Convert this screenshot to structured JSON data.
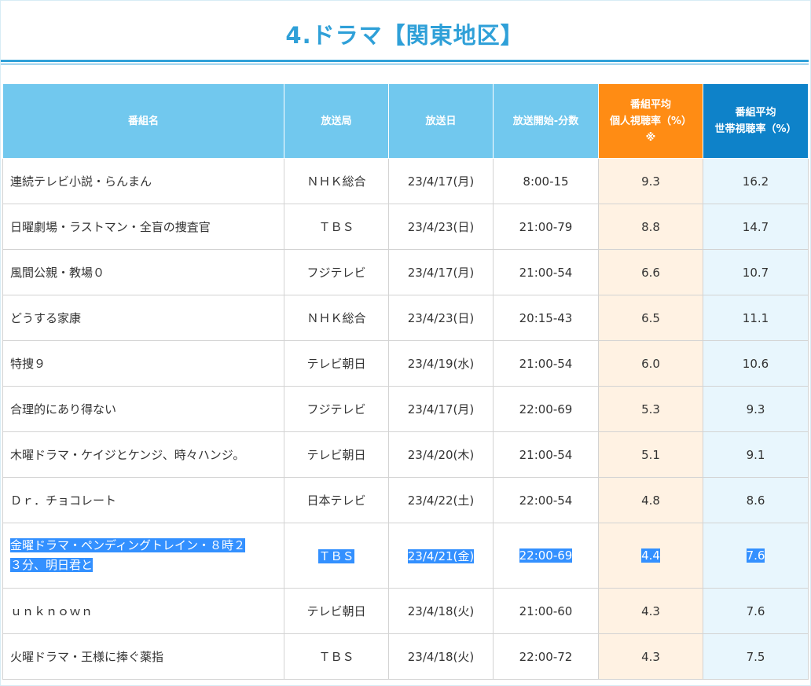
{
  "page": {
    "title": "4.ドラマ【関東地区】"
  },
  "table": {
    "headers": {
      "name": "番組名",
      "station": "放送局",
      "date": "放送日",
      "start": "放送開始-分数",
      "personal_line1": "番組平均",
      "personal_line2": "個人視聴率（%）",
      "personal_line3": "※",
      "household_line1": "番組平均",
      "household_line2": "世帯視聴率（%）"
    },
    "rows": [
      {
        "name": "連続テレビ小説・らんまん",
        "station": "ＮＨＫ総合",
        "date": "23/4/17(月)",
        "start": "8:00-15",
        "personal": "9.3",
        "household": "16.2"
      },
      {
        "name": "日曜劇場・ラストマン・全盲の捜査官",
        "station": "ＴＢＳ",
        "date": "23/4/23(日)",
        "start": "21:00-79",
        "personal": "8.8",
        "household": "14.7"
      },
      {
        "name": "風間公親・教場０",
        "station": "フジテレビ",
        "date": "23/4/17(月)",
        "start": "21:00-54",
        "personal": "6.6",
        "household": "10.7"
      },
      {
        "name": "どうする家康",
        "station": "ＮＨＫ総合",
        "date": "23/4/23(日)",
        "start": "20:15-43",
        "personal": "6.5",
        "household": "11.1"
      },
      {
        "name": "特捜９",
        "station": "テレビ朝日",
        "date": "23/4/19(水)",
        "start": "21:00-54",
        "personal": "6.0",
        "household": "10.6"
      },
      {
        "name": "合理的にあり得ない",
        "station": "フジテレビ",
        "date": "23/4/17(月)",
        "start": "22:00-69",
        "personal": "5.3",
        "household": "9.3"
      },
      {
        "name": "木曜ドラマ・ケイジとケンジ、時々ハンジ。",
        "station": "テレビ朝日",
        "date": "23/4/20(木)",
        "start": "21:00-54",
        "personal": "5.1",
        "household": "9.1"
      },
      {
        "name": "Ｄｒ．チョコレート",
        "station": "日本テレビ",
        "date": "23/4/22(土)",
        "start": "22:00-54",
        "personal": "4.8",
        "household": "8.6"
      },
      {
        "name_line1": "金曜ドラマ・ペンディングトレイン・８時２",
        "name_line2": "３分、明日君と",
        "station": "ＴＢＳ",
        "date": "23/4/21(金)",
        "start": "22:00-69",
        "personal": "4.4",
        "household": "7.6"
      },
      {
        "name": "ｕｎｋｎｏｗｎ",
        "station": "テレビ朝日",
        "date": "23/4/18(火)",
        "start": "21:00-60",
        "personal": "4.3",
        "household": "7.6"
      },
      {
        "name": "火曜ドラマ・王様に捧ぐ薬指",
        "station": "ＴＢＳ",
        "date": "23/4/18(火)",
        "start": "22:00-72",
        "personal": "4.3",
        "household": "7.5"
      }
    ]
  },
  "colors": {
    "title": "#2fa0d8",
    "header_default": "#71c8ee",
    "header_personal": "#ff8c14",
    "header_household": "#0e82c9",
    "cell_personal": "#fff2e3",
    "cell_household": "#e8f6fd",
    "selection": "#3390ff"
  }
}
